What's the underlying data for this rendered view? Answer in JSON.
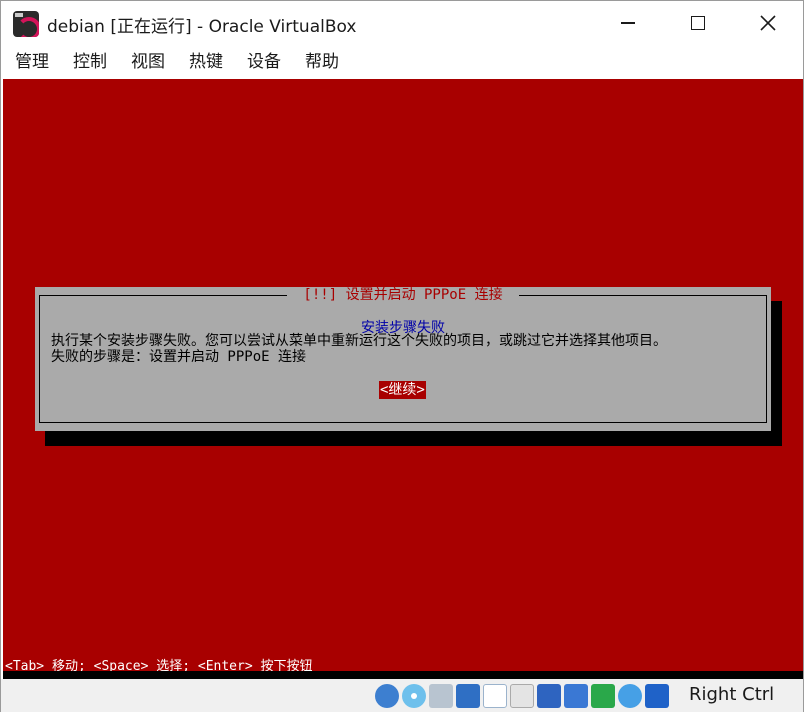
{
  "window": {
    "title": "debian [正在运行] - Oracle VirtualBox"
  },
  "menu": [
    "管理",
    "控制",
    "视图",
    "热键",
    "设备",
    "帮助"
  ],
  "dialog": {
    "title": "[!!] 设置并启动 PPPoE 连接",
    "heading": "安装步骤失败",
    "message_line1": "执行某个安装步骤失败。您可以尝试从菜单中重新运行这个失败的项目，或跳过它并选择其他项目。",
    "message_line2": "失败的步骤是：设置并启动 PPPoE 连接",
    "continue_label": "<继续>"
  },
  "helpbar": {
    "text": "<Tab> 移动; <Space> 选择; <Enter> 按下按钮"
  },
  "statusbar": {
    "host_key": "Right Ctrl",
    "icons": [
      "hard-disk-icon",
      "optical-drive-icon",
      "audio-icon",
      "network-icon",
      "usb-icon",
      "shared-folder-icon",
      "display-icon",
      "recording-icon",
      "cpu-icon",
      "mouse-integration-icon",
      "keyboard-capture-icon"
    ]
  },
  "colors": {
    "vm_background": "#a80000",
    "dialog_background": "#aaaaaa",
    "heading": "#0000a8",
    "title_text": "#a80000"
  }
}
